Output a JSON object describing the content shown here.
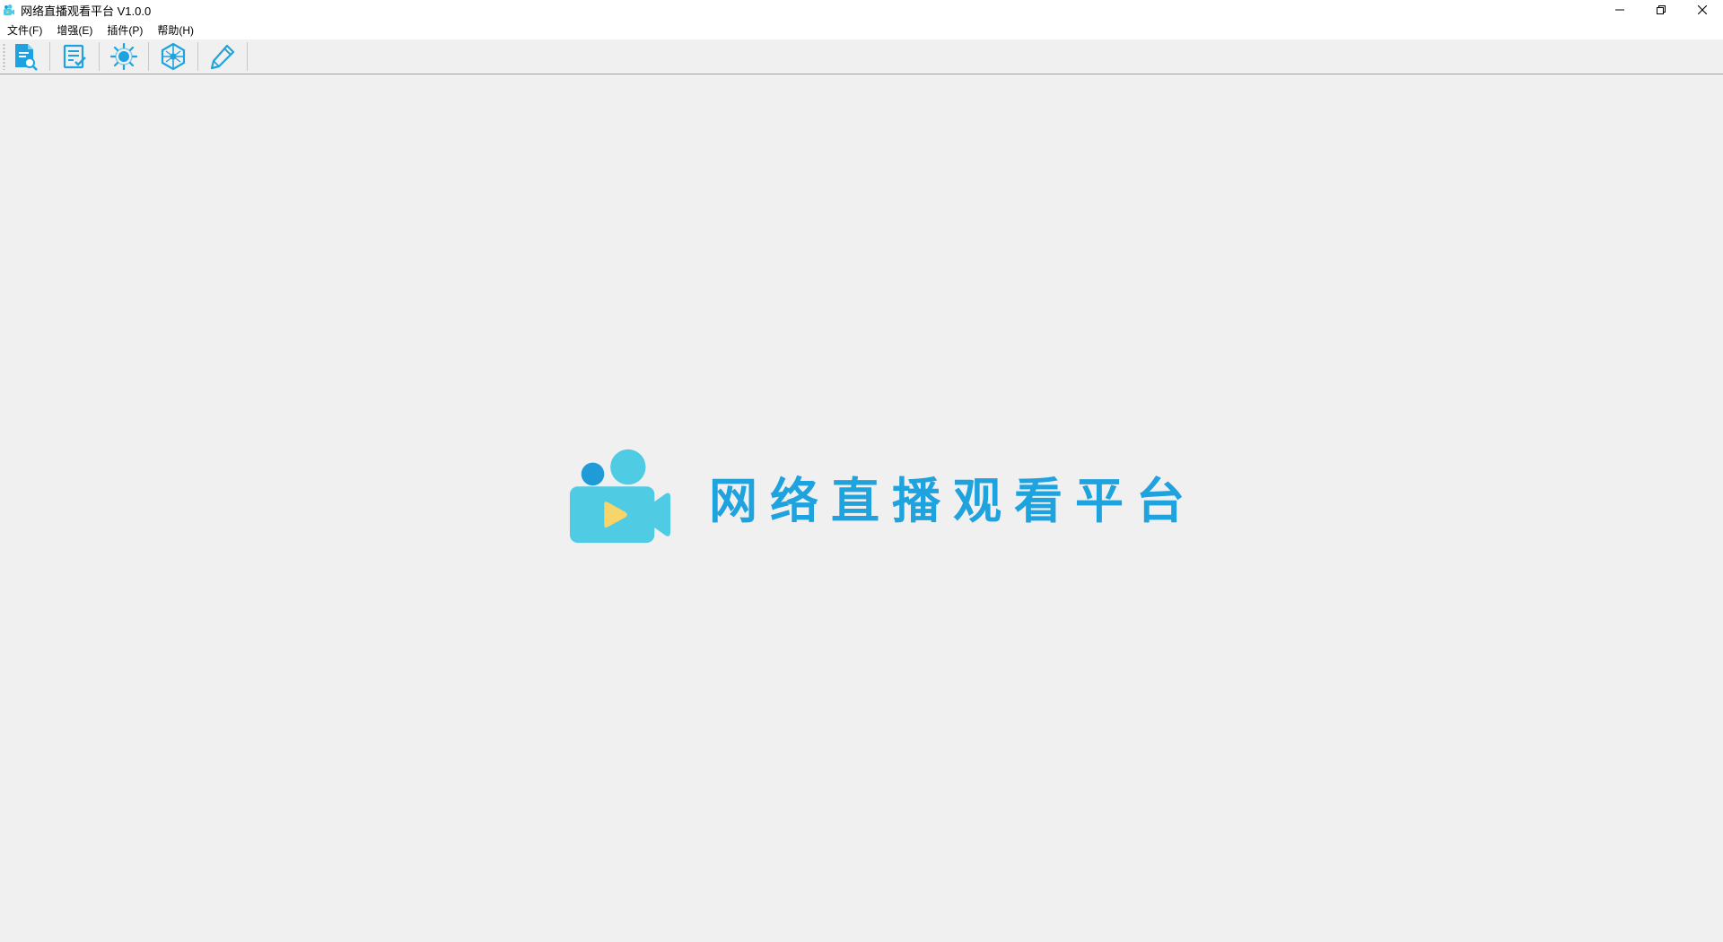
{
  "window": {
    "title": "网络直播观看平台 V1.0.0",
    "icon": "camera-app-icon",
    "controls": {
      "minimize": "minimize-icon",
      "restore": "restore-icon",
      "close": "close-icon"
    }
  },
  "menu": {
    "items": [
      {
        "label": "文件(F)"
      },
      {
        "label": "增强(E)"
      },
      {
        "label": "插件(P)"
      },
      {
        "label": "帮助(H)"
      }
    ]
  },
  "toolbar": {
    "buttons": [
      {
        "icon": "document-search-icon"
      },
      {
        "icon": "checklist-icon"
      },
      {
        "icon": "settings-sun-icon"
      },
      {
        "icon": "network-globe-icon"
      },
      {
        "icon": "pencil-icon"
      }
    ]
  },
  "splash": {
    "title": "网络直播观看平台",
    "logo": "video-camera-play-icon"
  },
  "colors": {
    "accent": "#1ea3de",
    "logo_light": "#4fcbe3",
    "logo_dot": "#1f9bd7",
    "play": "#f7d569",
    "background": "#f0f0f0"
  }
}
